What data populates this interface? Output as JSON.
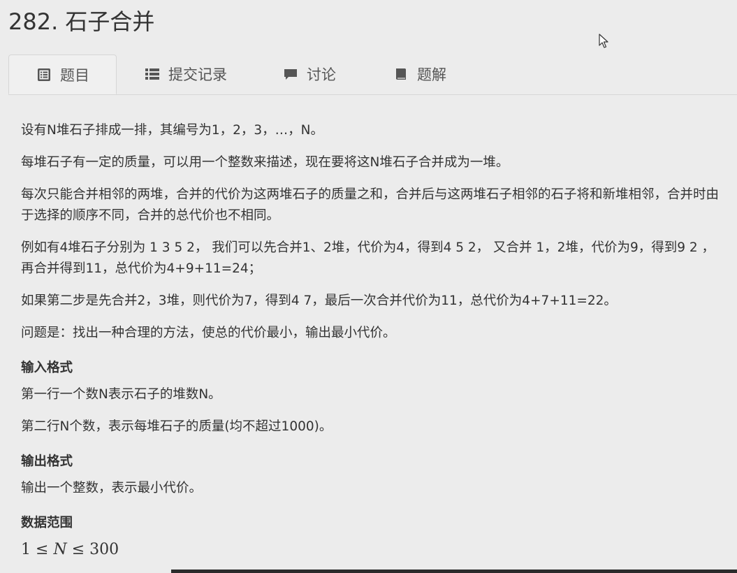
{
  "page_title": "282. 石子合并",
  "tabs": [
    {
      "label": "题目",
      "icon": "list-alt-icon",
      "active": true
    },
    {
      "label": "提交记录",
      "icon": "list-icon",
      "active": false
    },
    {
      "label": "讨论",
      "icon": "comment-icon",
      "active": false
    },
    {
      "label": "题解",
      "icon": "book-icon",
      "active": false
    }
  ],
  "description": {
    "paragraphs": [
      "设有N堆石子排成一排，其编号为1，2，3，…，N。",
      "每堆石子有一定的质量，可以用一个整数来描述，现在要将这N堆石子合并成为一堆。",
      "每次只能合并相邻的两堆，合并的代价为这两堆石子的质量之和，合并后与这两堆石子相邻的石子将和新堆相邻，合并时由于选择的顺序不同，合并的总代价也不相同。",
      "例如有4堆石子分别为 1 3 5 2， 我们可以先合并1、2堆，代价为4，得到4 5 2， 又合并 1，2堆，代价为9，得到9 2 ，再合并得到11，总代价为4+9+11=24；",
      "如果第二步是先合并2，3堆，则代价为7，得到4 7，最后一次合并代价为11，总代价为4+7+11=22。",
      "问题是：找出一种合理的方法，使总的代价最小，输出最小代价。"
    ]
  },
  "input_format": {
    "heading": "输入格式",
    "lines": [
      "第一行一个数N表示石子的堆数N。",
      "第二行N个数，表示每堆石子的质量(均不超过1000)。"
    ]
  },
  "output_format": {
    "heading": "输出格式",
    "lines": [
      "输出一个整数，表示最小代价。"
    ]
  },
  "data_range": {
    "heading": "数据范围",
    "left": "1",
    "op1": "≤",
    "var": "N",
    "op2": "≤",
    "right": "300"
  }
}
